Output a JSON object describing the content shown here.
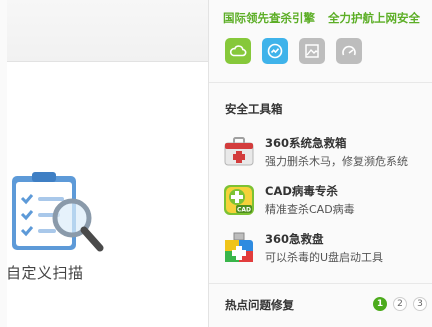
{
  "left": {
    "scan_label": "自定义扫描"
  },
  "right": {
    "slogan": [
      "国际领先查杀引擎",
      "全力护航上网安全"
    ],
    "feature_icons": [
      {
        "name": "cloud-icon",
        "color": "#86c83a"
      },
      {
        "name": "monitor-icon",
        "color": "#3fb3ea"
      },
      {
        "name": "image-icon",
        "color": "#bdbdbd"
      },
      {
        "name": "speed-icon",
        "color": "#bdbdbd"
      }
    ],
    "section_title": "安全工具箱",
    "tools": [
      {
        "name": "360系统急救箱",
        "desc": "强力删杀木马，修复濒危系统",
        "icon": "first-aid-kit-icon"
      },
      {
        "name": "CAD病毒专杀",
        "desc": "精准查杀CAD病毒",
        "icon": "cad-cross-icon"
      },
      {
        "name": "360急救盘",
        "desc": "可以杀毒的U盘启动工具",
        "icon": "usb-rescue-icon"
      }
    ],
    "hot_title": "热点问题修复",
    "pages": [
      "1",
      "2",
      "3"
    ],
    "active_page": "1"
  }
}
